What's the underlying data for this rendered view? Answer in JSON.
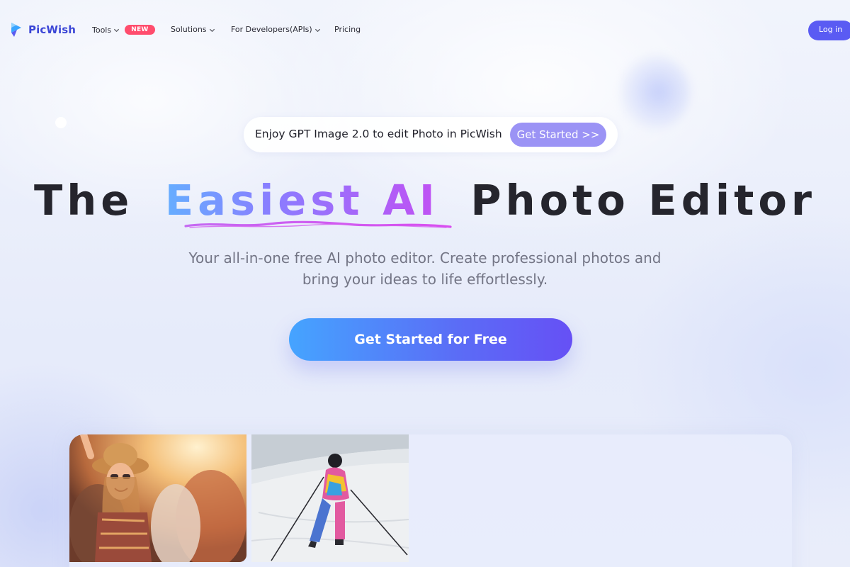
{
  "brand": {
    "name": "PicWish",
    "color": "#3b46d6"
  },
  "nav": {
    "tools": {
      "label": "Tools",
      "badge": "NEW"
    },
    "solutions": {
      "label": "Solutions"
    },
    "developers": {
      "label": "For Developers(APIs)"
    },
    "pricing": {
      "label": "Pricing"
    },
    "login": {
      "label": "Log in"
    }
  },
  "promo": {
    "text": "Enjoy GPT Image 2.0 to edit Photo in PicWish",
    "button": "Get Started >>"
  },
  "hero": {
    "headline_before": "The",
    "headline_highlight": "Easiest AI",
    "headline_after": "Photo Editor",
    "subtitle_line1": "Your all-in-one free AI photo editor. Create professional photos and",
    "subtitle_line2": "bring your ideas to life effortlessly.",
    "cta": "Get Started for Free"
  },
  "colors": {
    "accent": "#5a5bf3",
    "badge": "#ff4d6d",
    "promo_button": "#9b93f5"
  },
  "icons": {
    "logo": "picwish-logo-icon",
    "dropdown": "chevron-down-icon"
  },
  "gallery": {
    "images": [
      "festival-woman-photo",
      "skier-photo"
    ]
  }
}
